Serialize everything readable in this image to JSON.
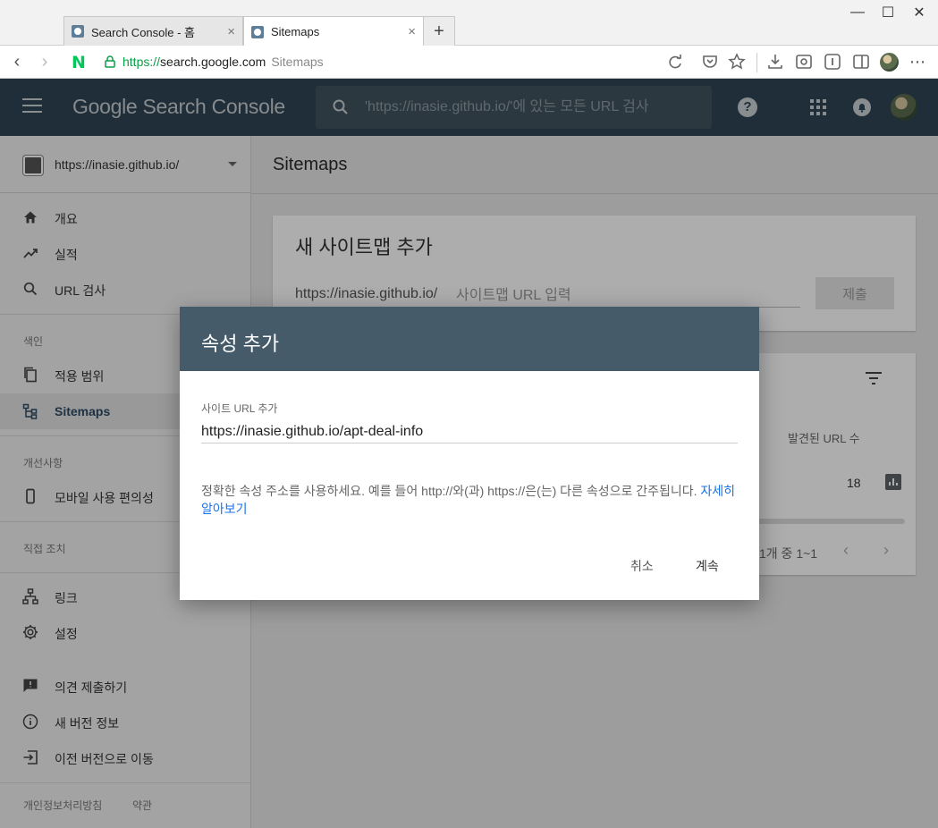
{
  "browser": {
    "tabs": [
      {
        "title": "Search Console - 홈",
        "close": "×"
      },
      {
        "title": "Sitemaps",
        "close": "×"
      }
    ],
    "new_tab": "+",
    "window": {
      "minimize": "—",
      "maximize": "☐",
      "close": "✕"
    },
    "address": {
      "scheme": "https://",
      "host": "search.google.com",
      "page_title": "Sitemaps"
    },
    "nav": {
      "back": "‹",
      "forward": "›"
    },
    "naver_logo": "N",
    "more": "⋯"
  },
  "header": {
    "logo": "Google Search Console",
    "search_placeholder": "'https://inasie.github.io/'에 있는 모든 URL 검사",
    "help": "?"
  },
  "sidebar": {
    "property": "https://inasie.github.io/",
    "items_top": [
      {
        "label": "개요",
        "icon": "home-icon"
      },
      {
        "label": "실적",
        "icon": "trending-up-icon"
      },
      {
        "label": "URL 검사",
        "icon": "search-icon"
      }
    ],
    "section_index": "색인",
    "items_index": [
      {
        "label": "적용 범위",
        "icon": "copy-icon"
      },
      {
        "label": "Sitemaps",
        "icon": "sitemap-icon"
      }
    ],
    "section_enhancements": "개선사항",
    "items_enhancements": [
      {
        "label": "모바일 사용 편의성",
        "icon": "phone-icon"
      }
    ],
    "section_manual": "직접 조치",
    "items_tools": [
      {
        "label": "링크",
        "icon": "links-icon"
      },
      {
        "label": "설정",
        "icon": "gear-icon"
      }
    ],
    "items_bottom": [
      {
        "label": "의견 제출하기",
        "icon": "feedback-icon"
      },
      {
        "label": "새 버전 정보",
        "icon": "info-icon"
      },
      {
        "label": "이전 버전으로 이동",
        "icon": "exit-icon"
      }
    ],
    "footer": {
      "privacy": "개인정보처리방침",
      "terms": "약관"
    }
  },
  "main": {
    "page_title": "Sitemaps",
    "add_sitemap": {
      "title": "새 사이트맵 추가",
      "prefix": "https://inasie.github.io/",
      "placeholder": "사이트맵 URL 입력",
      "submit": "제출"
    },
    "table": {
      "column": "발견된 URL 수",
      "value": "18",
      "pagination": "1개 중 1~1",
      "prev": "‹",
      "next": "›"
    }
  },
  "dialog": {
    "title": "속성 추가",
    "field_label": "사이트 URL 추가",
    "field_value": "https://inasie.github.io/apt-deal-info",
    "help": "정확한 속성 주소를 사용하세요. 예를 들어 http://와(과) https://은(는) 다른 속성으로 간주됩니다.",
    "help_link": "자세히 알아보기",
    "cancel": "취소",
    "continue": "계속"
  },
  "colors": {
    "header_bg": "#2f4553",
    "dialog_head": "#465b69",
    "link": "#1a73e8",
    "sidebar_active": "#2f4a62"
  }
}
